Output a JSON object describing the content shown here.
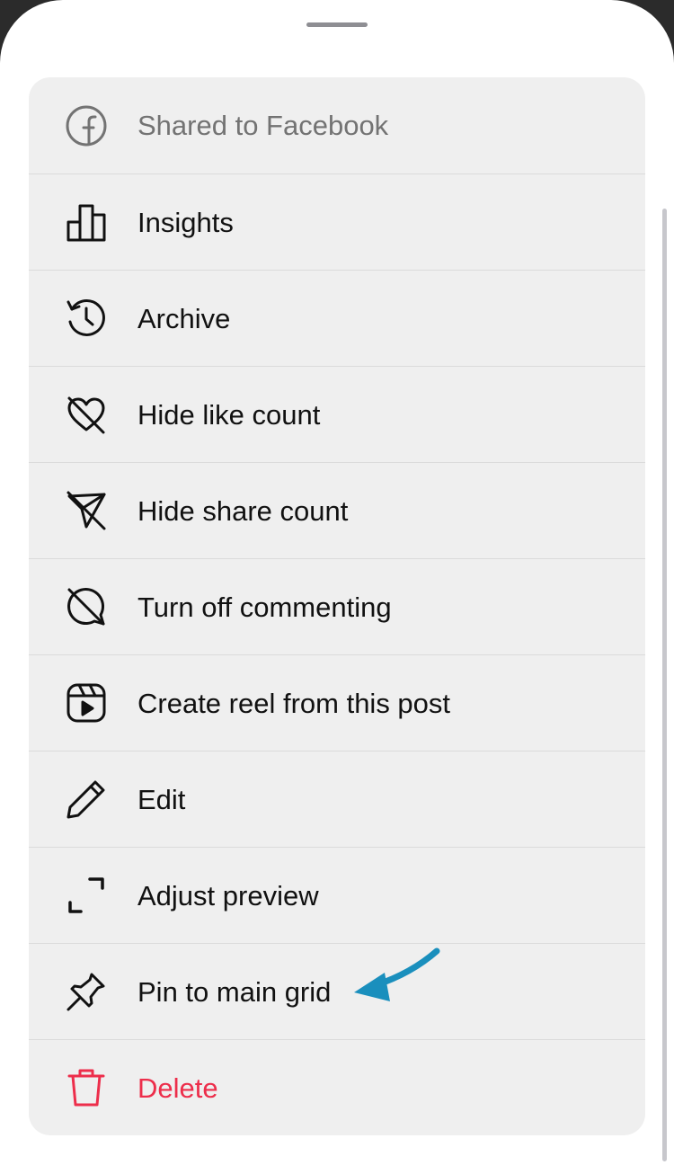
{
  "menu": {
    "items": [
      {
        "label": "Shared to Facebook",
        "icon": "facebook-icon"
      },
      {
        "label": "Insights",
        "icon": "bar-chart-icon"
      },
      {
        "label": "Archive",
        "icon": "archive-history-icon"
      },
      {
        "label": "Hide like count",
        "icon": "heart-off-icon"
      },
      {
        "label": "Hide share count",
        "icon": "share-off-icon"
      },
      {
        "label": "Turn off commenting",
        "icon": "comment-off-icon"
      },
      {
        "label": "Create reel from this post",
        "icon": "reel-icon"
      },
      {
        "label": "Edit",
        "icon": "pencil-icon"
      },
      {
        "label": "Adjust preview",
        "icon": "expand-icon"
      },
      {
        "label": "Pin to main grid",
        "icon": "pin-icon"
      },
      {
        "label": "Delete",
        "icon": "trash-icon"
      }
    ]
  },
  "colors": {
    "sheet_background": "#ffffff",
    "menu_background": "#efefef",
    "muted_text": "#737373",
    "destructive": "#ed2e4b",
    "annotation_arrow": "#1a8fbd"
  },
  "annotation": {
    "icon": "arrow-annotation-icon"
  }
}
